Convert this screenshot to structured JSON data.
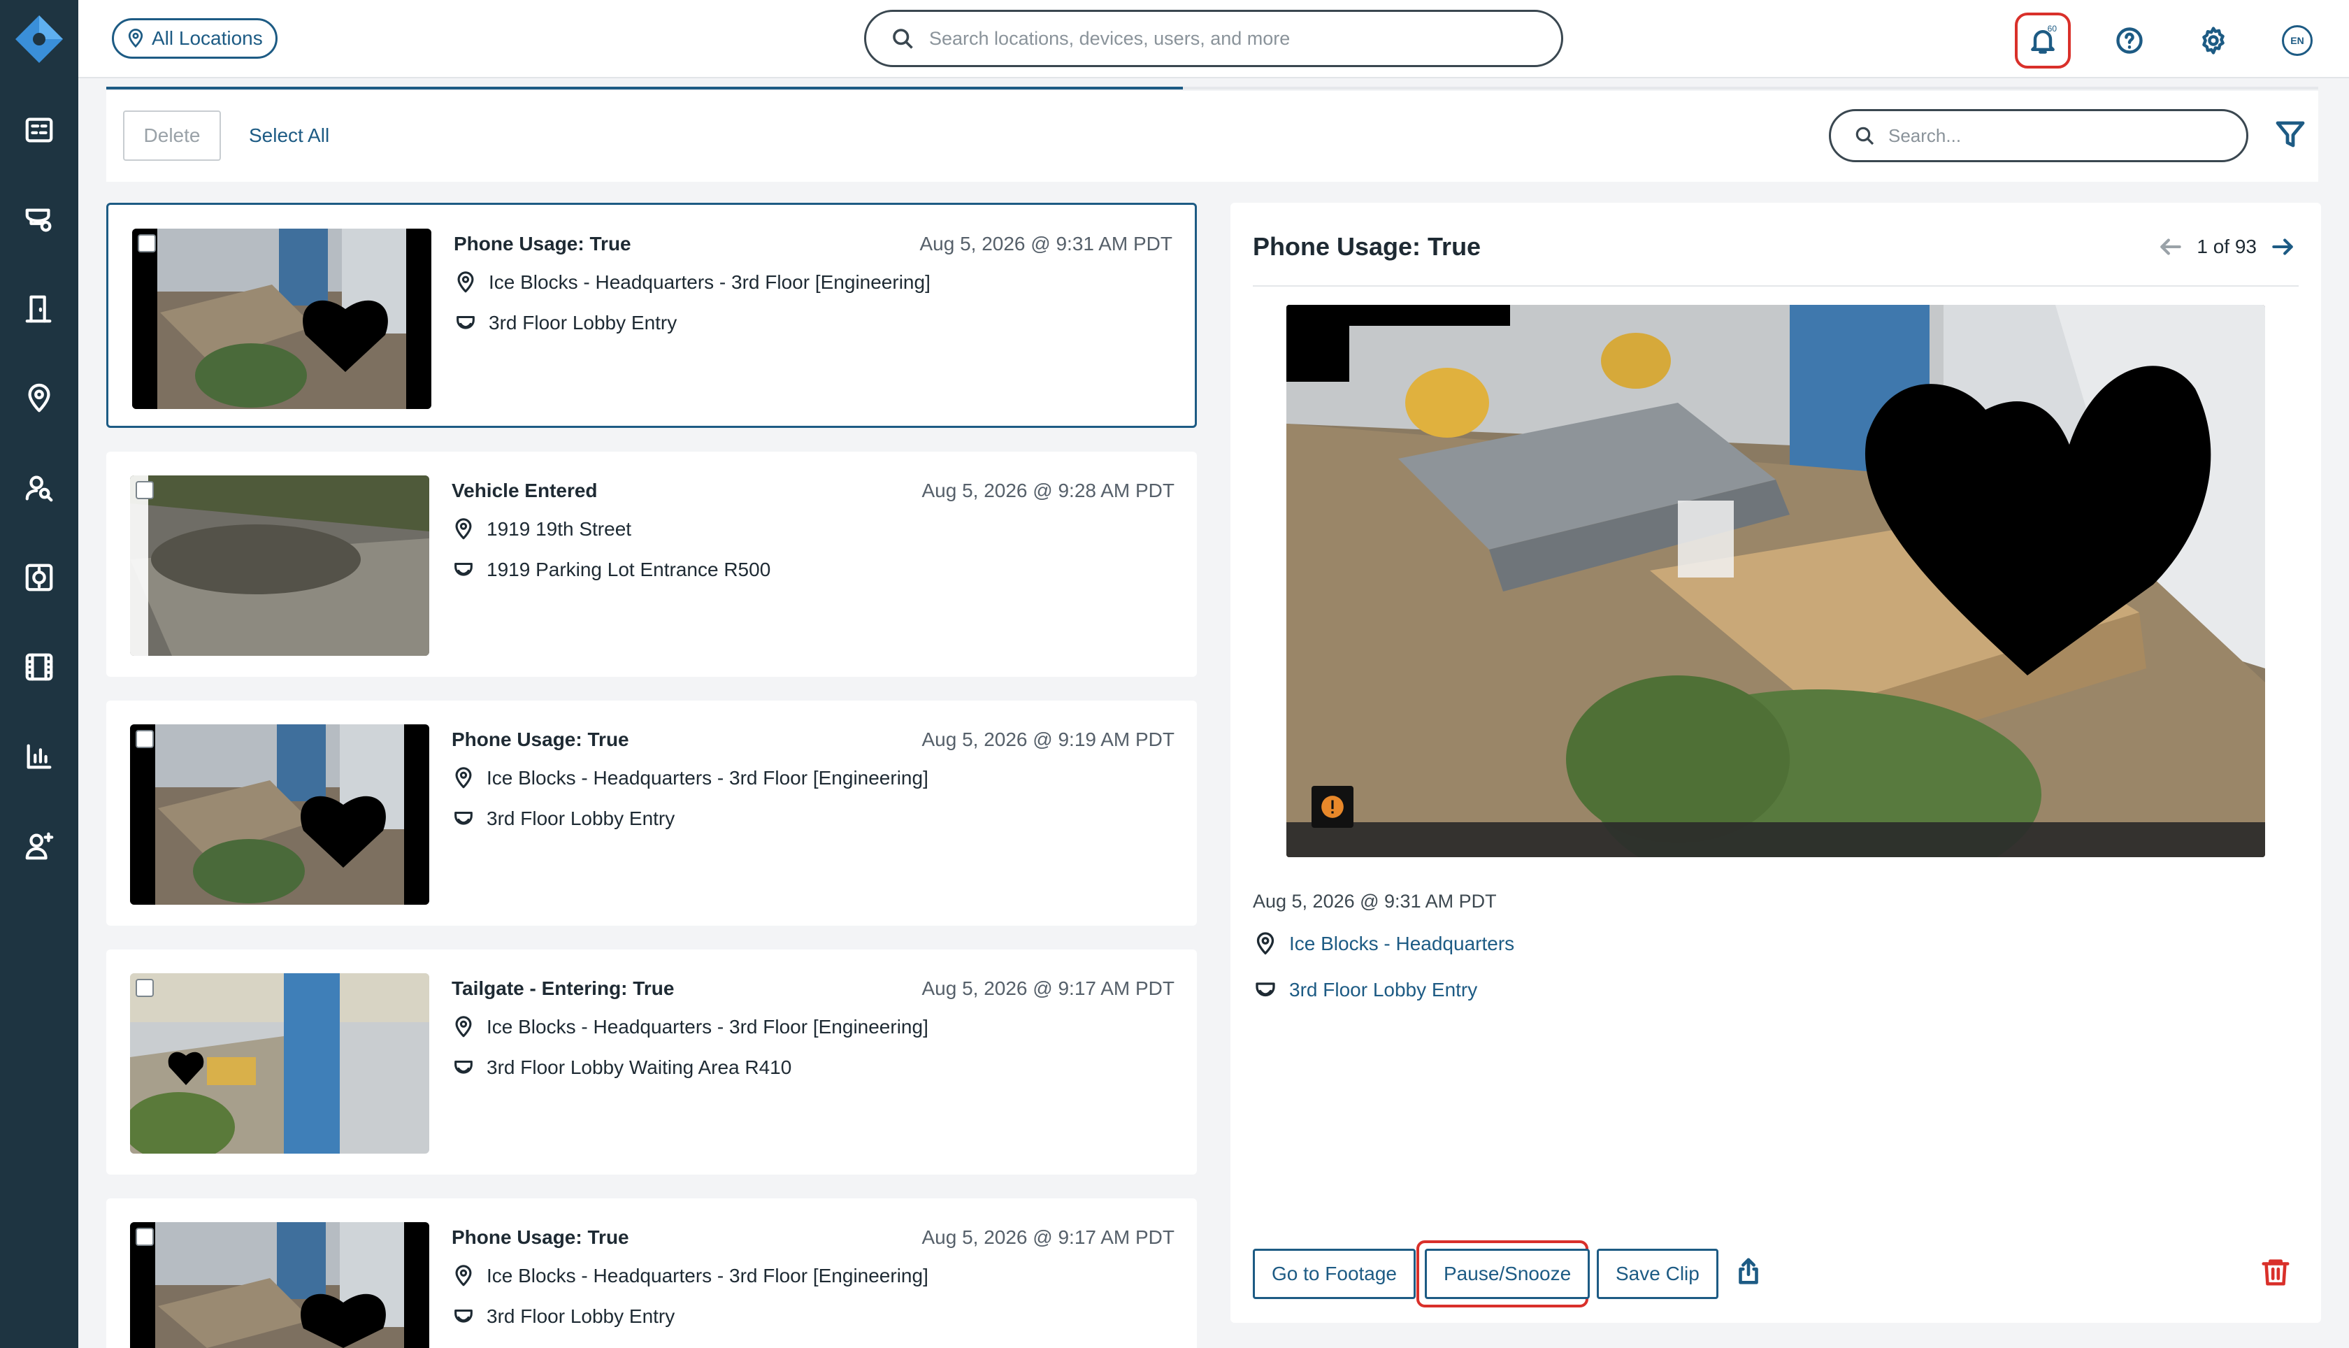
{
  "header": {
    "location_filter": "All Locations",
    "search_placeholder": "Search locations, devices, users, and more",
    "notification_count": "60",
    "language": "EN"
  },
  "sidebar": {
    "items": [
      {
        "name": "dashboard",
        "icon": "dashboard-icon"
      },
      {
        "name": "cameras",
        "icon": "camera-icon"
      },
      {
        "name": "access-control",
        "icon": "door-icon"
      },
      {
        "name": "locations",
        "icon": "location-pin-icon"
      },
      {
        "name": "people-search",
        "icon": "person-search-icon"
      },
      {
        "name": "alarms",
        "icon": "alarm-panel-icon"
      },
      {
        "name": "archives",
        "icon": "film-icon"
      },
      {
        "name": "analytics",
        "icon": "bar-chart-icon"
      },
      {
        "name": "users",
        "icon": "add-user-icon"
      }
    ]
  },
  "toolbar": {
    "delete_label": "Delete",
    "select_all_label": "Select All",
    "search_placeholder": "Search..."
  },
  "alerts": [
    {
      "title": "Phone Usage: True",
      "time": "Aug 5, 2026 @ 9:31 AM PDT",
      "location": "Ice Blocks - Headquarters - 3rd Floor [Engineering]",
      "camera": "3rd Floor Lobby Entry",
      "selected": true
    },
    {
      "title": "Vehicle Entered",
      "time": "Aug 5, 2026 @ 9:28 AM PDT",
      "location": "1919 19th Street",
      "camera": "1919 Parking Lot Entrance R500",
      "selected": false
    },
    {
      "title": "Phone Usage: True",
      "time": "Aug 5, 2026 @ 9:19 AM PDT",
      "location": "Ice Blocks - Headquarters - 3rd Floor [Engineering]",
      "camera": "3rd Floor Lobby Entry",
      "selected": false
    },
    {
      "title": "Tailgate - Entering: True",
      "time": "Aug 5, 2026 @ 9:17 AM PDT",
      "location": "Ice Blocks - Headquarters - 3rd Floor [Engineering]",
      "camera": "3rd Floor Lobby Waiting Area R410",
      "selected": false
    },
    {
      "title": "Phone Usage: True",
      "time": "Aug 5, 2026 @ 9:17 AM PDT",
      "location": "Ice Blocks - Headquarters - 3rd Floor [Engineering]",
      "camera": "3rd Floor Lobby Entry",
      "selected": false
    }
  ],
  "detail": {
    "title": "Phone Usage: True",
    "pager": "1 of 93",
    "timestamp": "Aug 5, 2026 @ 9:31 AM PDT",
    "location": "Ice Blocks - Headquarters",
    "camera": "3rd Floor Lobby Entry",
    "actions": {
      "go_to_footage": "Go to Footage",
      "pause_snooze": "Pause/Snooze",
      "save_clip": "Save Clip"
    }
  },
  "colors": {
    "sidebar_bg": "#1e3441",
    "accent": "#1d5b84",
    "danger": "#d9302a",
    "page_bg": "#f3f4f6"
  }
}
